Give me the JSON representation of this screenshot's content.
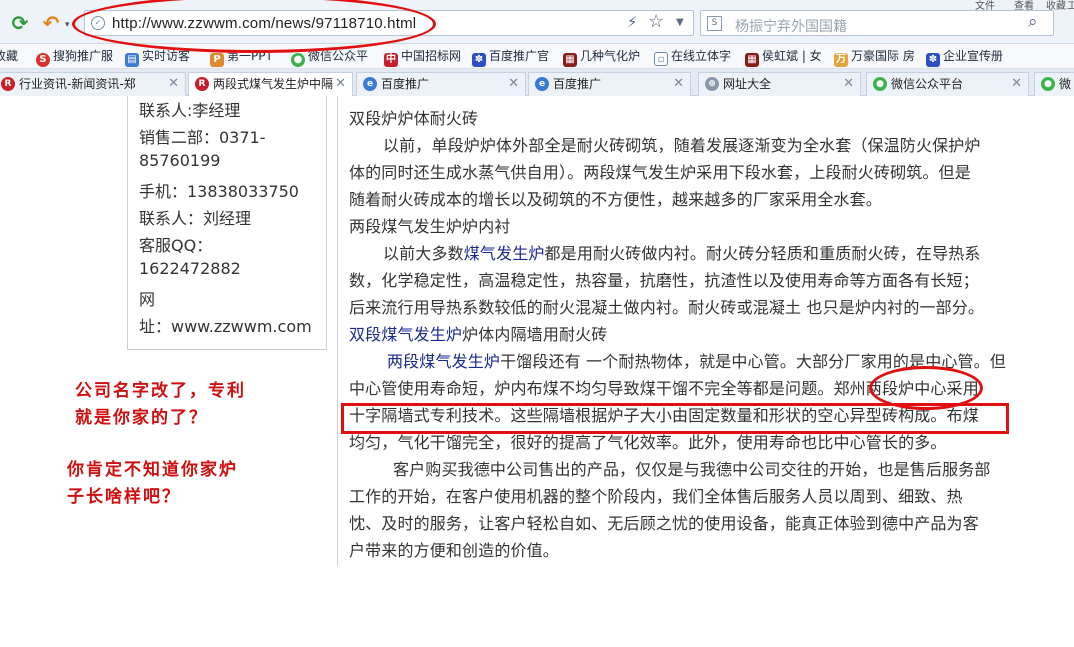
{
  "browser": {
    "url": "http://www.zzwwm.com/news/97118710.html",
    "search_placeholder": "杨振宁弃外国国籍",
    "topright_1": "文件",
    "topright_2": "查看",
    "topright_3": "收藏",
    "topright_4": "工"
  },
  "bookmarks": [
    {
      "label": "收藏",
      "icon": "star-icon"
    },
    {
      "label": "搜狗推广服",
      "icon": "sogou-icon"
    },
    {
      "label": "实时访客",
      "icon": "chart-icon"
    },
    {
      "label": "第一PPT",
      "icon": "ppt-icon"
    },
    {
      "label": "微信公众平",
      "icon": "wechat-icon"
    },
    {
      "label": "中国招标网",
      "icon": "flag-icon"
    },
    {
      "label": "百度推广官",
      "icon": "baidu-paw-icon"
    },
    {
      "label": "几种气化炉",
      "icon": "grid-icon"
    },
    {
      "label": "在线立体字",
      "icon": "page-icon"
    },
    {
      "label": "侯虹斌 | 女",
      "icon": "grid-icon"
    },
    {
      "label": "万豪国际 房",
      "icon": "hotel-icon"
    },
    {
      "label": "企业宣传册",
      "icon": "baidu-paw-icon"
    }
  ],
  "tabs": [
    {
      "label": "行业资讯-新闻资讯-郑",
      "active": false
    },
    {
      "label": "两段式煤气发生炉中隔",
      "active": true
    },
    {
      "label": "百度推广",
      "active": false
    },
    {
      "label": "百度推广",
      "active": false
    },
    {
      "label": "网址大全",
      "active": false
    },
    {
      "label": "微信公众平台",
      "active": false
    },
    {
      "label": "微",
      "active": false
    }
  ],
  "contact": {
    "line1": "联系人:李经理",
    "line2": "销售二部：0371-",
    "line3": "85760199",
    "line4": "手机：13838033750",
    "line5": "联系人：刘经理",
    "line6": "客服QQ：",
    "line7": "1622472882",
    "line8": "网",
    "line9": "址：www.zzwwm.com"
  },
  "article": {
    "h1": "双段炉炉体耐火砖",
    "p1_l1": "以前，单段炉炉体外部全是耐火砖砌筑，随着发展逐渐变为全水套（保温防火保护炉",
    "p1_l2": "体的同时还生成水蒸气供自用）。两段煤气发生炉采用下段水套，上段耐火砖砌筑。但是",
    "p1_l3": "随着耐火砖成本的增长以及砌筑的不方便性，越来越多的厂家采用全水套。",
    "h2": "两段煤气发生炉炉内衬",
    "p2_l1_a": "以前大多数",
    "p2_l1_link": "煤气发生炉",
    "p2_l1_b": "都是用耐火砖做内衬。耐火砖分轻质和重质耐火砖，在导热系",
    "p2_l2": "数，化学稳定性，高温稳定性，热容量，抗磨性，抗渣性以及使用寿命等方面各有长短；",
    "p2_l3": "后来流行用导热系数较低的耐火混凝土做内衬。耐火砖或混凝土 也只是炉内衬的一部分。",
    "h3_a": "双段",
    "h3_link": "煤气发生炉",
    "h3_b": "炉体内隔墙用耐火砖",
    "p3_l1_link": "两段煤气发生炉",
    "p3_l1_b": "干馏段还有 一个耐热物体，就是中心管。大部分厂家用的是中心管。但",
    "p3_l2": "中心管使用寿命短，炉内布煤不均匀导致煤干馏不完全等都是问题。郑州两段炉中心采用",
    "p3_l3": "十字隔墙式专利技术。这些隔墙根据炉子大小由固定数量和形状的空心异型砖构成。布煤",
    "p3_l4": "均匀，气化干馏完全，很好的提高了气化效率。此外，使用寿命也比中心管长的多。",
    "p4_l1": "客户购买我德中公司售出的产品，仅仅是与我德中公司交往的开始，也是售后服务部",
    "p4_l2": "工作的开始，在客户使用机器的整个阶段内，我们全体售后服务人员以周到、细致、热",
    "p4_l3": "忱、及时的服务，让客户轻松自如、无后顾之忧的使用设备，能真正体验到德中产品为客",
    "p4_l4": "户带来的方便和创造的价值。"
  },
  "annotations": {
    "a1_l1": "公司名字改了，专利",
    "a1_l2": "就是你家的了？",
    "a2_l1": "你肯定不知道你家炉",
    "a2_l2": "子长啥样吧？"
  },
  "colors": {
    "annotation_red": "#e01010",
    "link_blue": "#1b2a8f"
  }
}
